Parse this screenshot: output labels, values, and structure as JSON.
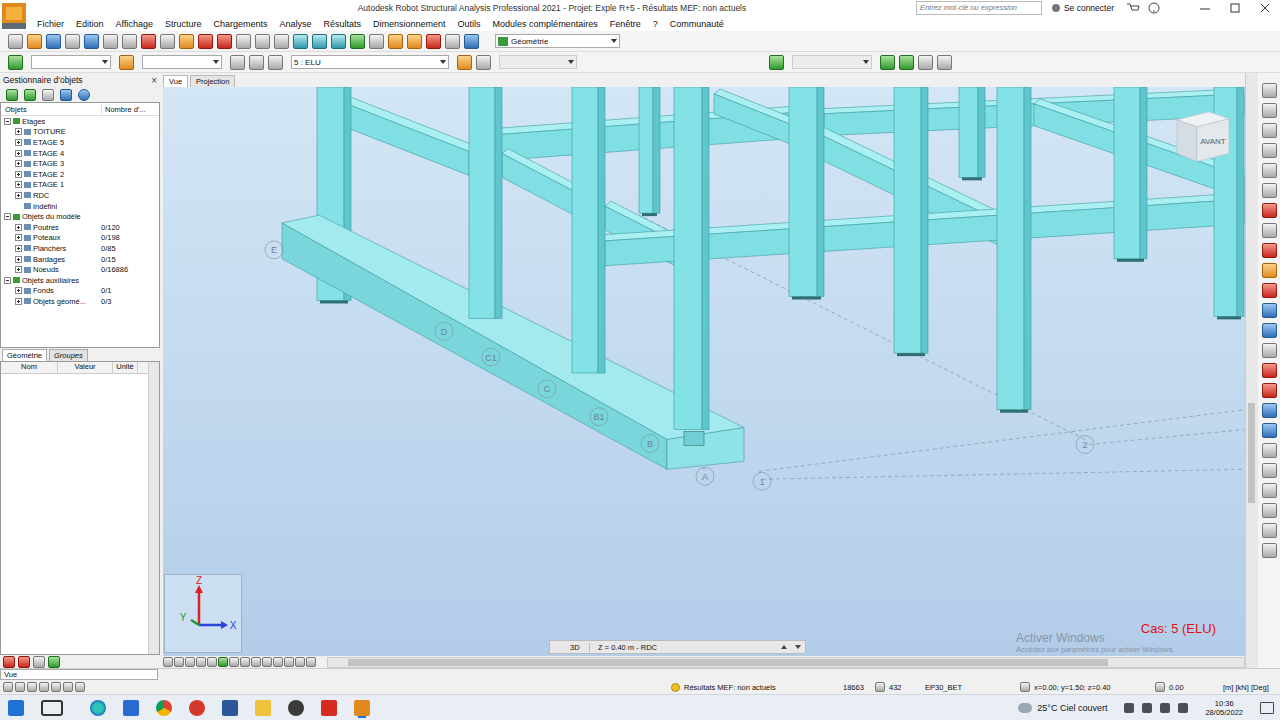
{
  "window": {
    "title": "Autodesk Robot Structural Analysis Professional 2021 - Projet: Exple R+5 - Résultats MEF: non actuels",
    "search_placeholder": "Entrez mot-clé ou expression",
    "sign_in": "Se connecter"
  },
  "menu": [
    "Fichier",
    "Edition",
    "Affichage",
    "Structure",
    "Chargements",
    "Analyse",
    "Résultats",
    "Dimensionnement",
    "Outils",
    "Modules complémentaires",
    "Fenêtre",
    "?",
    "Communauté"
  ],
  "toolbar": {
    "display_dropdown": "Géométrie",
    "case_dropdown": "5 : ELU"
  },
  "object_manager": {
    "title": "Gestionnaire d'objets",
    "close": "×",
    "columns": [
      "Objets",
      "Nombre d'..."
    ],
    "tree": [
      {
        "label": "Etages",
        "count": "",
        "depth": 0,
        "kind": "group",
        "expanded": true
      },
      {
        "label": "TOITURE",
        "count": "",
        "depth": 1,
        "kind": "group",
        "expanded": false
      },
      {
        "label": "ETAGE 5",
        "count": "",
        "depth": 1,
        "kind": "group",
        "expanded": false
      },
      {
        "label": "ETAGE 4",
        "count": "",
        "depth": 1,
        "kind": "group",
        "expanded": false
      },
      {
        "label": "ETAGE 3",
        "count": "",
        "depth": 1,
        "kind": "group",
        "expanded": false
      },
      {
        "label": "ETAGE 2",
        "count": "",
        "depth": 1,
        "kind": "group",
        "expanded": false
      },
      {
        "label": "ETAGE 1",
        "count": "",
        "depth": 1,
        "kind": "group",
        "expanded": false
      },
      {
        "label": "RDC",
        "count": "",
        "depth": 1,
        "kind": "group",
        "expanded": false
      },
      {
        "label": "Indéfini",
        "count": "",
        "depth": 1,
        "kind": "leaf",
        "expanded": false
      },
      {
        "label": "Objets du modèle",
        "count": "",
        "depth": 0,
        "kind": "group",
        "expanded": true
      },
      {
        "label": "Poutres",
        "count": "0/120",
        "depth": 1,
        "kind": "group",
        "expanded": false
      },
      {
        "label": "Poteaux",
        "count": "0/198",
        "depth": 1,
        "kind": "group",
        "expanded": false
      },
      {
        "label": "Planchers",
        "count": "0/85",
        "depth": 1,
        "kind": "group",
        "expanded": false
      },
      {
        "label": "Bardages",
        "count": "0/15",
        "depth": 1,
        "kind": "group",
        "expanded": false
      },
      {
        "label": "Noeuds",
        "count": "0/16886",
        "depth": 1,
        "kind": "group",
        "expanded": false
      },
      {
        "label": "Objets auxiliaires",
        "count": "",
        "depth": 0,
        "kind": "group",
        "expanded": true
      },
      {
        "label": "Fonds",
        "count": "0/1",
        "depth": 1,
        "kind": "group",
        "expanded": false
      },
      {
        "label": "Objets géomé...",
        "count": "0/3",
        "depth": 1,
        "kind": "group",
        "expanded": false
      }
    ]
  },
  "panel_tabs": [
    {
      "label": "Géométrie",
      "selected": true
    },
    {
      "label": "Groupes",
      "selected": false
    }
  ],
  "properties": {
    "columns": [
      "Nom",
      "Valeur",
      "Unité"
    ]
  },
  "view_tabs": [
    {
      "label": "Vue",
      "selected": true
    },
    {
      "label": "Projection",
      "selected": false
    }
  ],
  "viewport": {
    "case_label": "Cas: 5 (ELU)",
    "view_cube": "AVANT",
    "axis_labels": [
      "E",
      "D",
      "C1",
      "C",
      "B1",
      "B",
      "A",
      "1",
      "2"
    ],
    "triad": {
      "z": "Z",
      "y": "Y",
      "x": "X"
    },
    "watermark_title": "Activer Windows",
    "watermark_subtitle": "Accédez aux paramètres pour activer Windows.",
    "view_mode": "3D",
    "level": "Z = 0.40 m - RDC"
  },
  "status_bar": {
    "view_field": "Vue",
    "results": "Résultats MEF: non actuels",
    "nodes": "18663",
    "bars": "432",
    "material": "EP30_BET",
    "coordinates": "x=0.00; y=1.50; z=0.40",
    "angle": "0.00",
    "units": "[m] [kN] [Deg]"
  },
  "taskbar": {
    "weather": "25°C  Ciel couvert",
    "time": "10:36",
    "date": "28/05/2022"
  }
}
